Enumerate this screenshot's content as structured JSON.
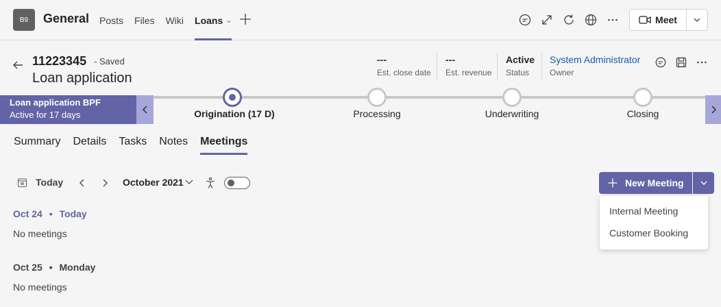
{
  "header": {
    "avatar_initials": "B9",
    "team_name": "General",
    "tabs": [
      {
        "label": "Posts"
      },
      {
        "label": "Files"
      },
      {
        "label": "Wiki"
      },
      {
        "label": "Loans"
      }
    ],
    "meet_label": "Meet"
  },
  "record": {
    "number": "11223345",
    "saved_status": "- Saved",
    "title": "Loan application",
    "fields": [
      {
        "value": "---",
        "label": "Est. close date"
      },
      {
        "value": "---",
        "label": "Est. revenue"
      },
      {
        "value": "Active",
        "label": "Status"
      },
      {
        "value": "System Administrator",
        "label": "Owner"
      }
    ]
  },
  "bpf": {
    "name": "Loan application BPF",
    "duration": "Active for 17 days",
    "stages": [
      {
        "label": "Origination  (17 D)",
        "active": true
      },
      {
        "label": "Processing",
        "active": false
      },
      {
        "label": "Underwriting",
        "active": false
      },
      {
        "label": "Closing",
        "active": false
      }
    ]
  },
  "subtabs": [
    "Summary",
    "Details",
    "Tasks",
    "Notes",
    "Meetings"
  ],
  "toolbar": {
    "today_label": "Today",
    "month_label": "October 2021",
    "new_meeting_label": "New Meeting"
  },
  "menu": {
    "items": [
      "Internal Meeting",
      "Customer Booking"
    ]
  },
  "agenda": [
    {
      "date": "Oct 24",
      "sep": "•",
      "day": "Today",
      "empty": "No meetings"
    },
    {
      "date": "Oct 25",
      "sep": "•",
      "day": "Monday",
      "empty": "No meetings"
    }
  ],
  "colors": {
    "accent": "#6264a7",
    "accent_light": "#a6a7d8",
    "link": "#115ea3"
  }
}
